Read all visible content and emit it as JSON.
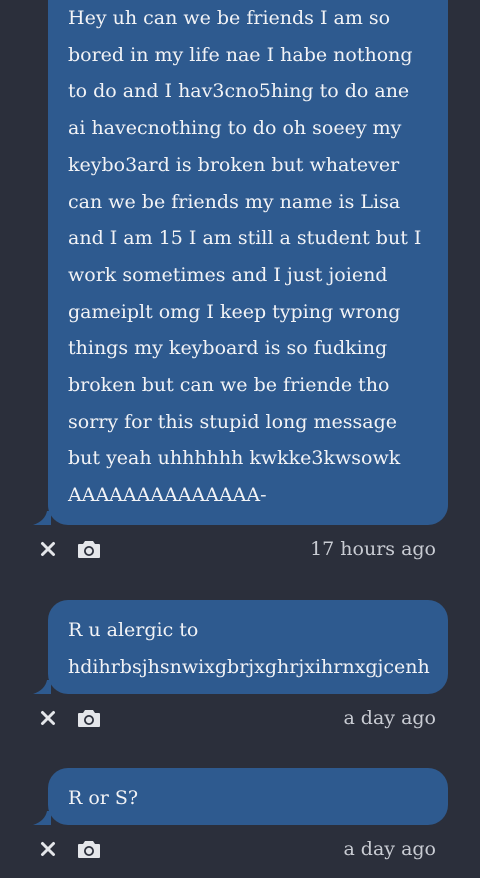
{
  "messages": [
    {
      "text": "Hey uh can we be friends I am so\nbored in my life nae I habe nothong\nto do and I hav3cno5hing to do ane\nai havecnothing to do oh soeey my\nkeybo3ard is broken but whatever\ncan we be friends my name is Lisa\nand I am 15 I am still a student but I\nwork sometimes and I just joiend\ngameiplt omg I keep typing wrong\nthings my keyboard is so fudking\nbroken but can we be friende tho\nsorry for this stupid long message\nbut yeah uhhhhhh kwkke3kwsowk\nAAAAAAAAAAAAAA-",
      "timestamp": "17 hours ago"
    },
    {
      "text": "R u alergic to\nhdihrbsjhsnwixgbrjxghrjxihrnxgjcenh",
      "timestamp": "a day ago"
    },
    {
      "text": "R or S?",
      "timestamp": "a day ago"
    }
  ],
  "icons": {
    "delete": "close-icon",
    "photo": "camera-icon"
  },
  "colors": {
    "background": "#2b2f3b",
    "bubble": "#2e5a8f",
    "text": "#f2f3f6",
    "meta_text": "#c9ccd3",
    "icon": "#e4e6ea"
  }
}
